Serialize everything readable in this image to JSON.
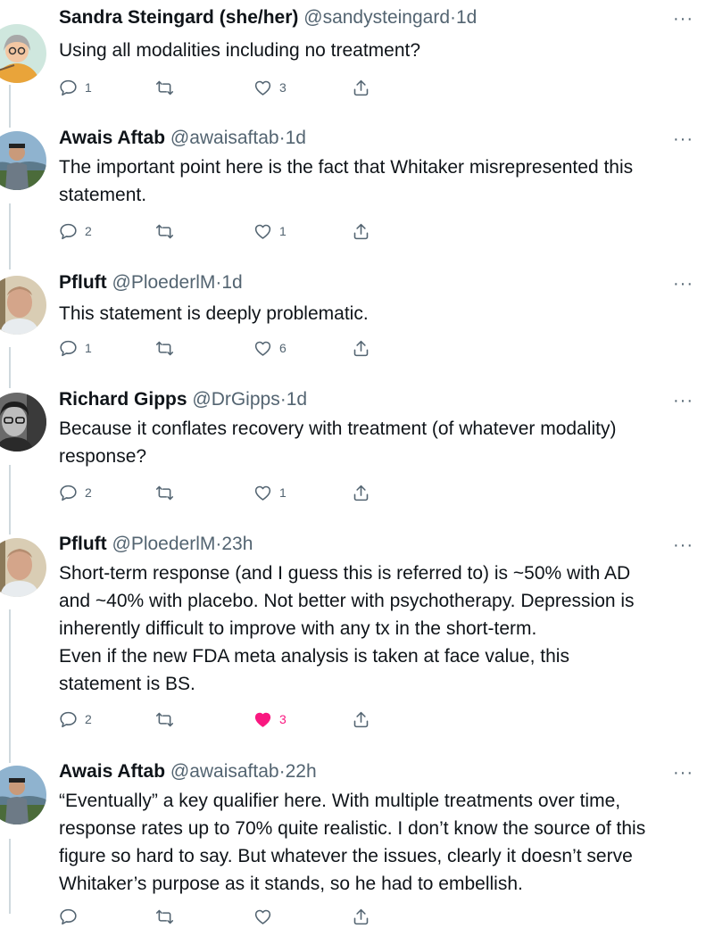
{
  "tweets": [
    {
      "name": "Sandra Steingard (she/her)",
      "handle": "@sandysteingard",
      "separator": "·",
      "time": "1d",
      "text": "Using all modalities including no treatment?",
      "replies": "1",
      "retweets": "",
      "likes": "3",
      "liked": false,
      "avatar_icon": "avatar-illustration-icon"
    },
    {
      "name": "Awais Aftab",
      "handle": "@awaisaftab",
      "separator": "·",
      "time": "1d",
      "text": "The important point here is the fact that Whitaker misrepresented this\nstatement.",
      "replies": "2",
      "retweets": "",
      "likes": "1",
      "liked": false,
      "avatar_icon": "avatar-photo-icon"
    },
    {
      "name": "Pfluft",
      "handle": "@PloederlM",
      "separator": "·",
      "time": "1d",
      "text": "This statement is deeply problematic.",
      "replies": "1",
      "retweets": "",
      "likes": "6",
      "liked": false,
      "avatar_icon": "avatar-photo-icon"
    },
    {
      "name": "Richard Gipps",
      "handle": "@DrGipps",
      "separator": "·",
      "time": "1d",
      "text": "Because it conflates recovery with treatment (of whatever modality)\nresponse?",
      "replies": "2",
      "retweets": "",
      "likes": "1",
      "liked": false,
      "avatar_icon": "avatar-photo-icon"
    },
    {
      "name": "Pfluft",
      "handle": "@PloederlM",
      "separator": "·",
      "time": "23h",
      "text": "Short-term response (and I guess this is referred to) is ~50% with AD\nand ~40% with placebo. Not better with psychotherapy. Depression is\ninherently difficult to improve with any tx in the short-term.\nEven if the new FDA meta analysis is taken at face value, this\nstatement is BS.",
      "replies": "2",
      "retweets": "",
      "likes": "3",
      "liked": true,
      "avatar_icon": "avatar-photo-icon"
    },
    {
      "name": "Awais Aftab",
      "handle": "@awaisaftab",
      "separator": "·",
      "time": "22h",
      "text": "“Eventually” a key qualifier here. With multiple treatments over time,\nresponse rates up to 70% quite realistic. I don’t know the source of this\nfigure so hard to say. But whatever the issues, clearly it doesn’t serve\nWhitaker’s purpose as it stands, so he had to embellish.",
      "replies": "",
      "retweets": "",
      "likes": "",
      "liked": false,
      "avatar_icon": "avatar-photo-icon"
    }
  ],
  "icons": {
    "reply": "reply-icon",
    "retweet": "retweet-icon",
    "like": "heart-icon",
    "share": "share-icon",
    "more": "more-options-icon"
  },
  "more_glyph": "···",
  "colors": {
    "text": "#0f1419",
    "secondary": "#536471",
    "like_active": "#f91880",
    "thread_line": "#cfd9de"
  }
}
